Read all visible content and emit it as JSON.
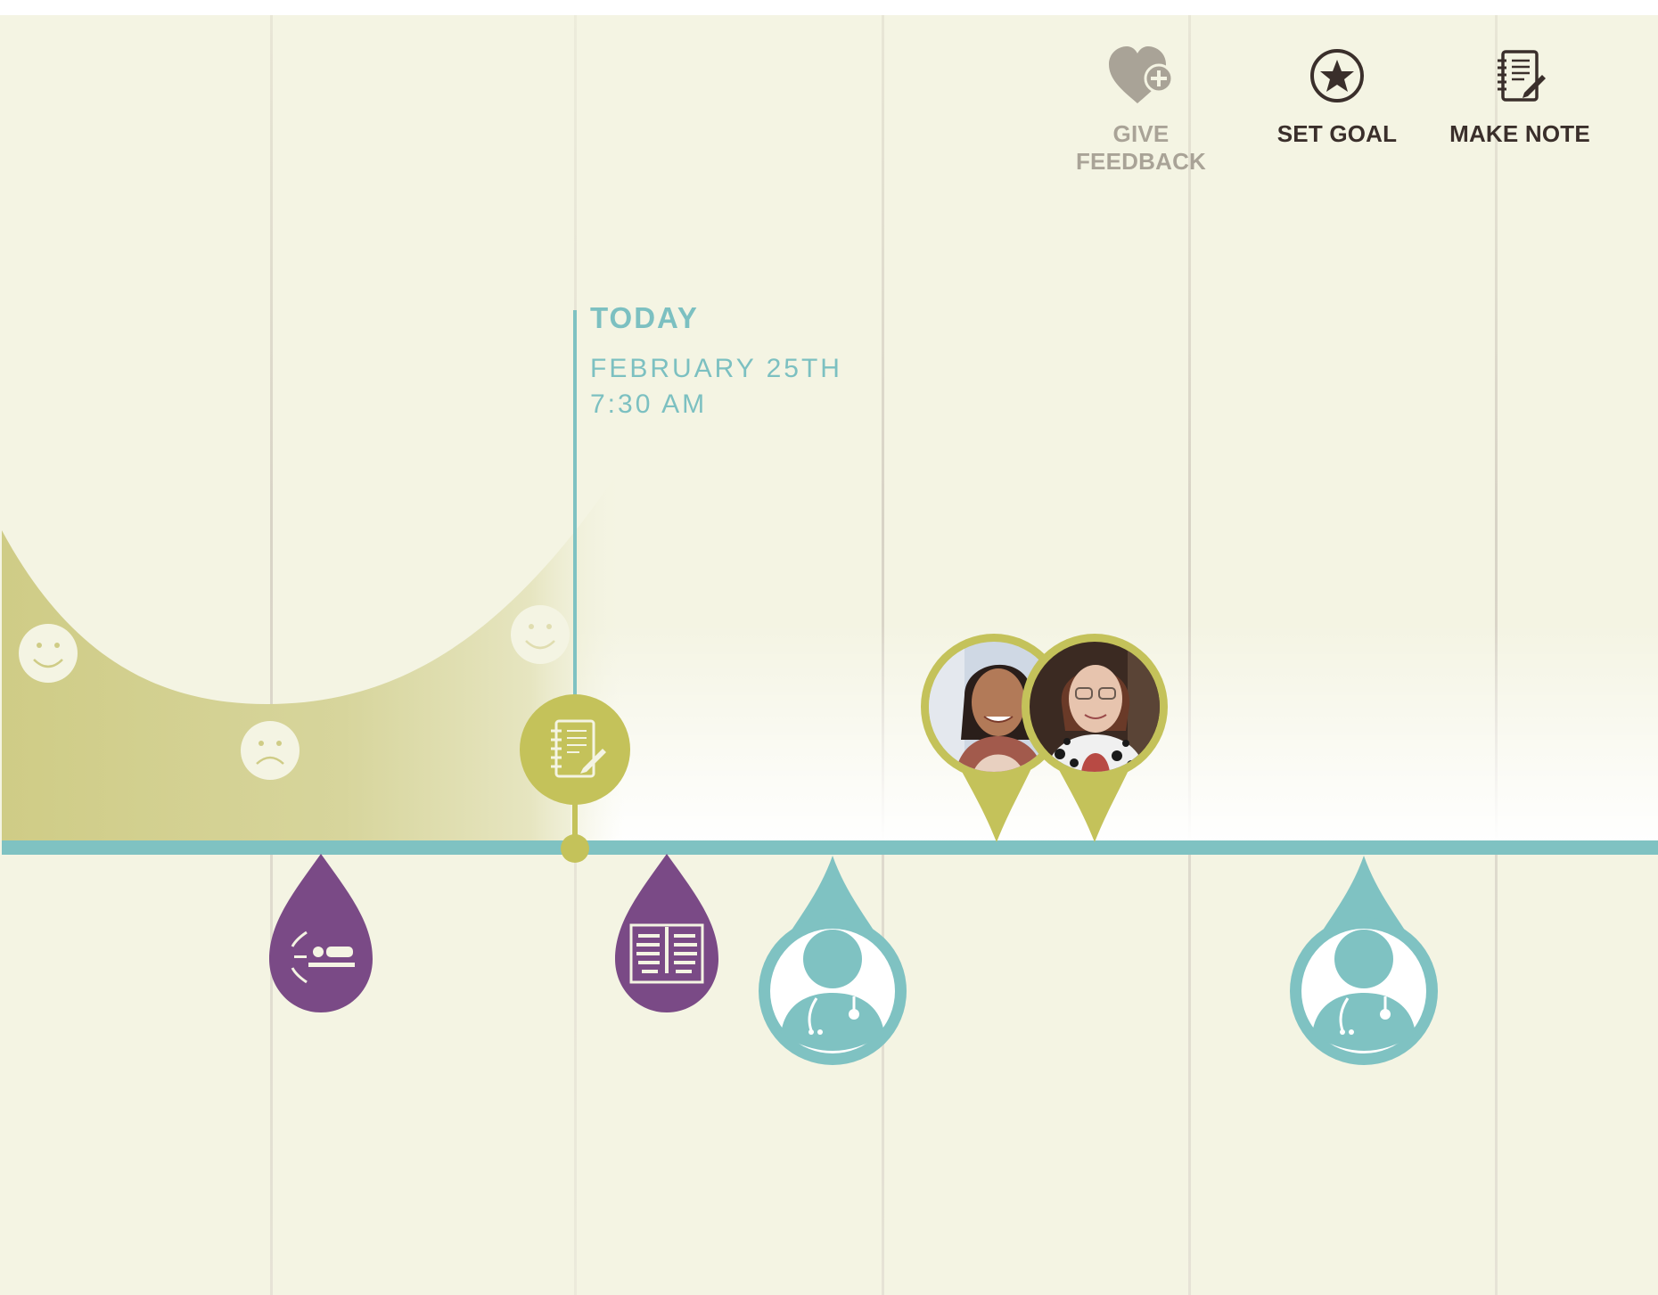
{
  "actions": {
    "give_feedback": {
      "label": "GIVE FEEDBACK",
      "icon": "heart-plus-icon",
      "color": "#a9a397"
    },
    "set_goal": {
      "label": "SET GOAL",
      "icon": "star-circle-icon",
      "color": "#3a2f2b"
    },
    "make_note": {
      "label": "MAKE NOTE",
      "icon": "notebook-icon",
      "color": "#3a2f2b"
    }
  },
  "today": {
    "title": "TODAY",
    "date": "FEBRUARY 25TH",
    "time": "7:30 AM"
  },
  "mood_markers": [
    {
      "mood": "happy",
      "icon": "happy-face-icon"
    },
    {
      "mood": "sad",
      "icon": "sad-face-icon"
    },
    {
      "mood": "happy",
      "icon": "happy-face-icon"
    }
  ],
  "timeline_events": [
    {
      "type": "procedure",
      "icon": "patient-treatment-icon",
      "color": "#7a4a86"
    },
    {
      "type": "note",
      "icon": "notebook-icon",
      "color": "#c4c25a"
    },
    {
      "type": "imaging",
      "icon": "xray-icon",
      "color": "#7a4a86"
    },
    {
      "type": "doctor-visit",
      "icon": "doctor-icon",
      "color": "#7fc2c2"
    },
    {
      "type": "care-team",
      "icon": "person-photo",
      "color": "#c4c25a"
    },
    {
      "type": "care-team",
      "icon": "person-photo",
      "color": "#c4c25a"
    },
    {
      "type": "doctor-visit",
      "icon": "doctor-icon",
      "color": "#7fc2c2"
    }
  ],
  "colors": {
    "background": "#f4f4e3",
    "timeline": "#7fc2c2",
    "mood_fill": "#cfcc86",
    "accent_green": "#c4c25a",
    "accent_purple": "#7a4a86",
    "accent_teal": "#7fc2c2"
  }
}
